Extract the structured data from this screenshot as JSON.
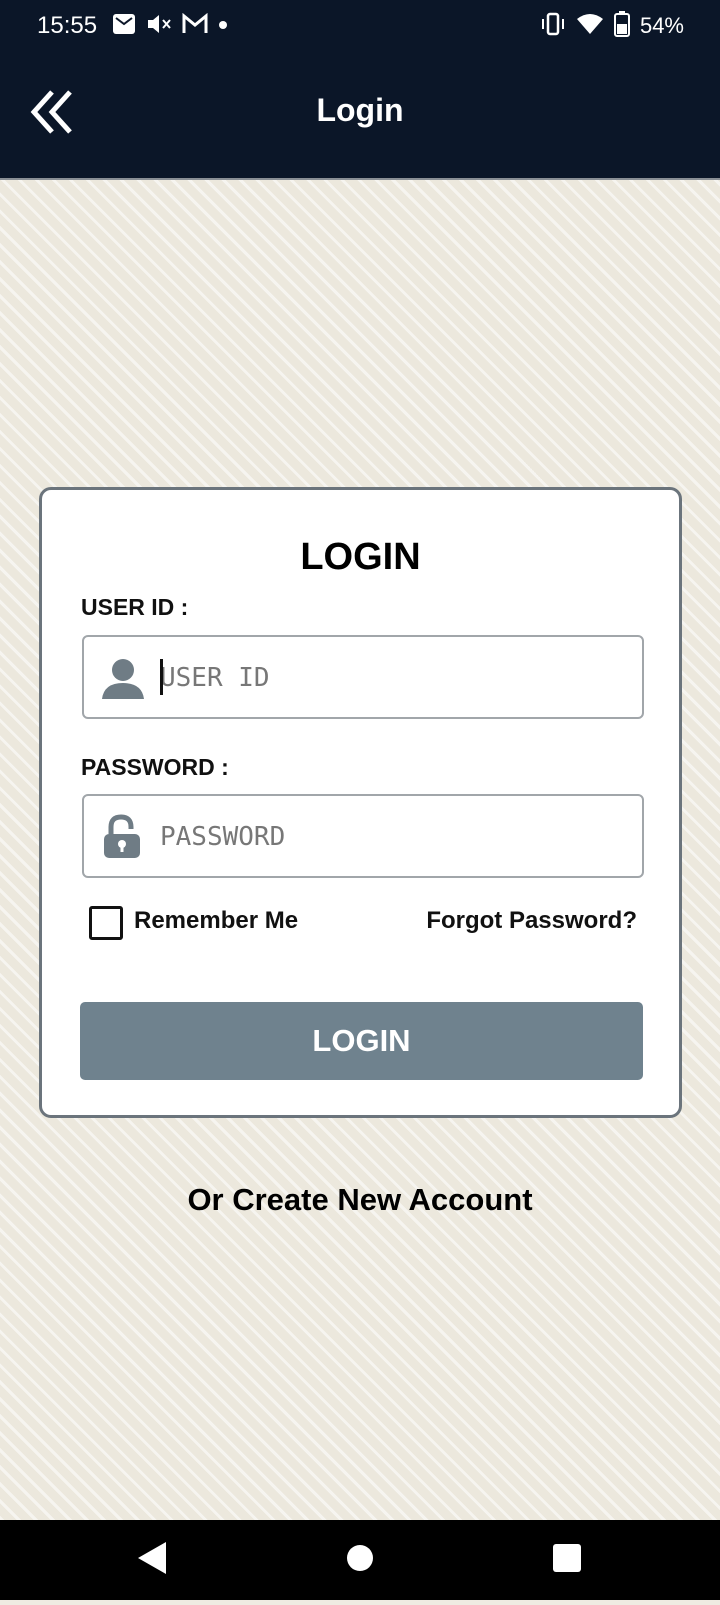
{
  "status_bar": {
    "time": "15:55",
    "battery": "54%",
    "icons": [
      "mail-icon",
      "mute-icon",
      "gmail-icon",
      "dot-icon",
      "vibrate-icon",
      "wifi-icon",
      "battery-icon"
    ]
  },
  "app_bar": {
    "title": "Login",
    "back_icon": "double-chevron-left-icon"
  },
  "login_card": {
    "title": "LOGIN",
    "user_id": {
      "label": "USER ID :",
      "placeholder": "USER ID",
      "value": "",
      "icon": "user-icon"
    },
    "password": {
      "label": "PASSWORD :",
      "placeholder": "PASSWORD",
      "value": "",
      "icon": "unlock-icon"
    },
    "remember_me": {
      "label": "Remember Me",
      "checked": false
    },
    "forgot_password": "Forgot Password?",
    "login_button": "LOGIN"
  },
  "create_account": "Or Create New Account",
  "colors": {
    "app_bar_bg": "#0b1628",
    "login_button_bg": "#6f828e",
    "background": "#ece8dd"
  },
  "nav_bar": {
    "icons": [
      "nav-back-icon",
      "nav-home-icon",
      "nav-recents-icon"
    ]
  }
}
